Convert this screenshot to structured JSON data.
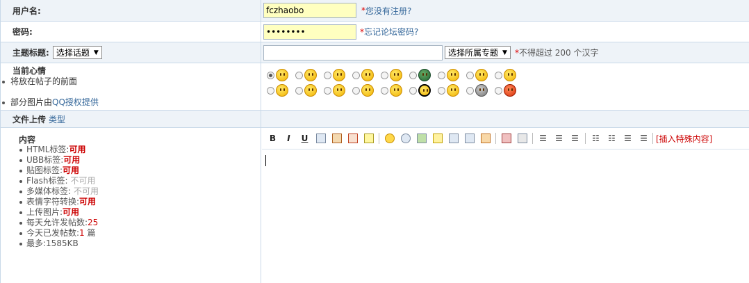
{
  "username": {
    "label": "用户名:",
    "value": "fczhaobo",
    "register_link": "您没有注册?"
  },
  "password": {
    "label": "密码:",
    "value": "••••••••",
    "forgot_link": "忘记论坛密码?"
  },
  "subject": {
    "label": "主题标题:",
    "topic_select": "选择话题",
    "title_value": "",
    "category_select": "选择所属专题",
    "hint": "不得超过 200 个汉字"
  },
  "mood": {
    "label": "当前心情",
    "note1": "将放在帖子的前面",
    "note2_prefix": "部分图片由",
    "note2_link": "QQ授权提供"
  },
  "upload": {
    "label": "文件上传",
    "type_link": "类型"
  },
  "content": {
    "label": "内容",
    "items": [
      {
        "name": "HTML标签:",
        "value": "可用",
        "status": "on"
      },
      {
        "name": "UBB标签:",
        "value": "可用",
        "status": "on"
      },
      {
        "name": "贴图标签:",
        "value": "可用",
        "status": "on"
      },
      {
        "name": "Flash标签:",
        "value": "不可用",
        "status": "off"
      },
      {
        "name": "多媒体标签:",
        "value": "不可用",
        "status": "off"
      },
      {
        "name": "表情字符转换:",
        "value": "可用",
        "status": "on"
      },
      {
        "name": "上传图片:",
        "value": "可用",
        "status": "on"
      },
      {
        "name": "每天允许发帖数:",
        "value": "25",
        "status": "on"
      },
      {
        "name": "今天已发帖数:",
        "value": "1 篇",
        "status": "count"
      },
      {
        "name": "最多:",
        "value": "1585KB",
        "status": "plain"
      }
    ],
    "insert_special": "[插入特殊内容]"
  },
  "colors": {
    "required": "#dd0000",
    "link": "#336699",
    "available": "#cc0000",
    "unavailable": "#aaaaaa",
    "border": "#c8d8e8",
    "alt_row": "#eef3f8"
  }
}
